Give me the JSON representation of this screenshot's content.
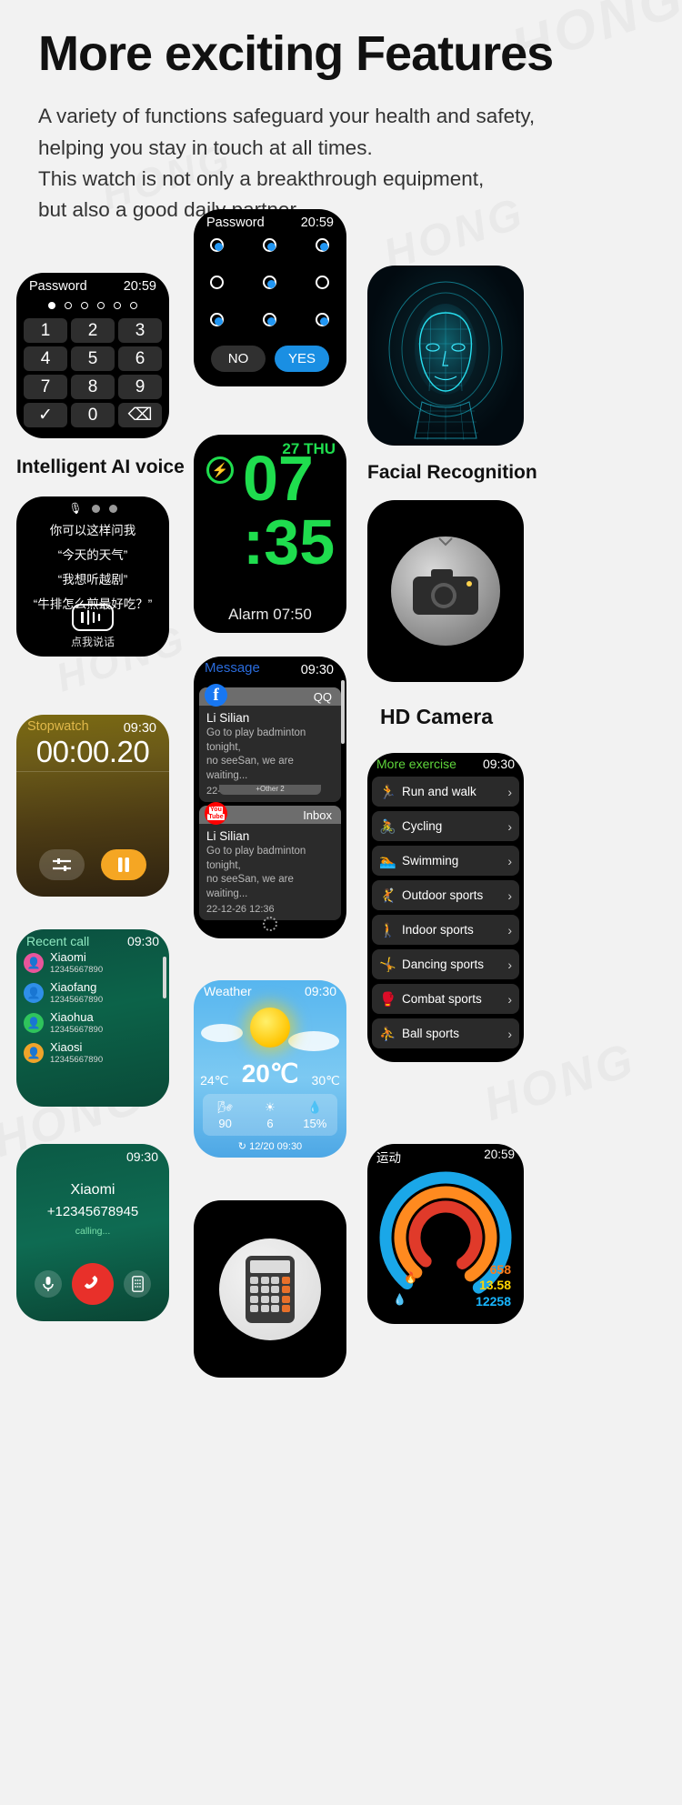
{
  "header": {
    "title": "More exciting Features",
    "sub1": "A variety of functions safeguard your health and safety,",
    "sub2": "helping you stay in touch at all times.",
    "sub3": "This watch is not only a breakthrough equipment,",
    "sub4": "but also a good daily partner."
  },
  "captions": {
    "ai_voice": "Intelligent AI voice",
    "facial": "Facial Recognition",
    "camera": "HD Camera"
  },
  "keypad": {
    "title": "Password",
    "time": "20:59",
    "dots_total": 6,
    "dots_filled": 1,
    "keys": [
      "1",
      "2",
      "3",
      "4",
      "5",
      "6",
      "7",
      "8",
      "9",
      "✓",
      "0",
      "⌫"
    ]
  },
  "pattern": {
    "title": "Password",
    "time": "20:59",
    "no_label": "NO",
    "yes_label": "YES"
  },
  "clock": {
    "date": "27 THU",
    "hour": "07",
    "minute": ":35",
    "alarm": "Alarm 07:50",
    "bolt_icon": "⚡"
  },
  "ai": {
    "line1": "你可以这样问我",
    "line2": "“今天的天气”",
    "line3": "“我想听越剧”",
    "line4": "“牛排怎么煎最好吃？”",
    "button_caption": "点我说话"
  },
  "stopwatch": {
    "label": "Stopwatch",
    "time": "09:30",
    "value": "00:00.20"
  },
  "message": {
    "title": "Message",
    "time": "09:30",
    "cards": [
      {
        "app": "facebook",
        "tab": "QQ",
        "name": "Li Silian",
        "text1": "Go to play badminton tonight,",
        "text2": "no seeSan, we are waiting...",
        "date": "22-12-26  12:30",
        "other": "+Other 2"
      },
      {
        "app": "youtube",
        "tab": "Inbox",
        "name": "Li Silian",
        "text1": "Go to play badminton tonight,",
        "text2": "no seeSan, we are waiting...",
        "date": "22-12-26  12:36",
        "other": ""
      }
    ]
  },
  "exercise": {
    "title": "More exercise",
    "time": "09:30",
    "items": [
      {
        "label": "Run and walk",
        "icon": "🏃",
        "color": "#ffd400"
      },
      {
        "label": "Cycling",
        "icon": "🚴",
        "color": "#ffa31a"
      },
      {
        "label": "Swimming",
        "icon": "🏊",
        "color": "#ffe14d"
      },
      {
        "label": "Outdoor sports",
        "icon": "🤾",
        "color": "#2f9bff"
      },
      {
        "label": "Indoor sports",
        "icon": "🚶",
        "color": "#f0a02a"
      },
      {
        "label": "Dancing sports",
        "icon": "🤸",
        "color": "#ffe14d"
      },
      {
        "label": "Combat sports",
        "icon": "🥊",
        "color": "#46e03a"
      },
      {
        "label": "Ball sports",
        "icon": "⛹",
        "color": "#ffd400"
      }
    ],
    "chevron": "›"
  },
  "recent_call": {
    "title": "Recent call",
    "time": "09:30",
    "items": [
      {
        "name": "Xiaomi",
        "phone": "12345667890",
        "color": "#e8559b"
      },
      {
        "name": "Xiaofang",
        "phone": "12345667890",
        "color": "#2f8fe8"
      },
      {
        "name": "Xiaohua",
        "phone": "12345667890",
        "color": "#2fc45c"
      },
      {
        "name": "Xiaosi",
        "phone": "12345667890",
        "color": "#f0a42a"
      }
    ]
  },
  "weather": {
    "title": "Weather",
    "time": "09:30",
    "temp_low": "24℃",
    "temp_main": "20℃",
    "temp_high": "30℃",
    "metrics": [
      {
        "icon": "🌬",
        "value": "90"
      },
      {
        "icon": "☀",
        "value": "6"
      },
      {
        "icon": "💧",
        "value": "15%"
      }
    ],
    "footer": "↻  12/20  09:30"
  },
  "call": {
    "time": "09:30",
    "name": "Xiaomi",
    "number": "+12345678945",
    "status": "calling...",
    "btn_mic": "🎙",
    "btn_end": "📞",
    "btn_keypad": "📱"
  },
  "sport": {
    "title": "运动",
    "time": "20:59",
    "values": [
      {
        "text": "658",
        "color": "#ff7a18",
        "icon": "🔥"
      },
      {
        "text": "13.58",
        "color": "#ffd400",
        "icon": ""
      },
      {
        "text": "12258",
        "color": "#18b6ff",
        "icon": "💧"
      }
    ]
  },
  "watermark": "HONG"
}
